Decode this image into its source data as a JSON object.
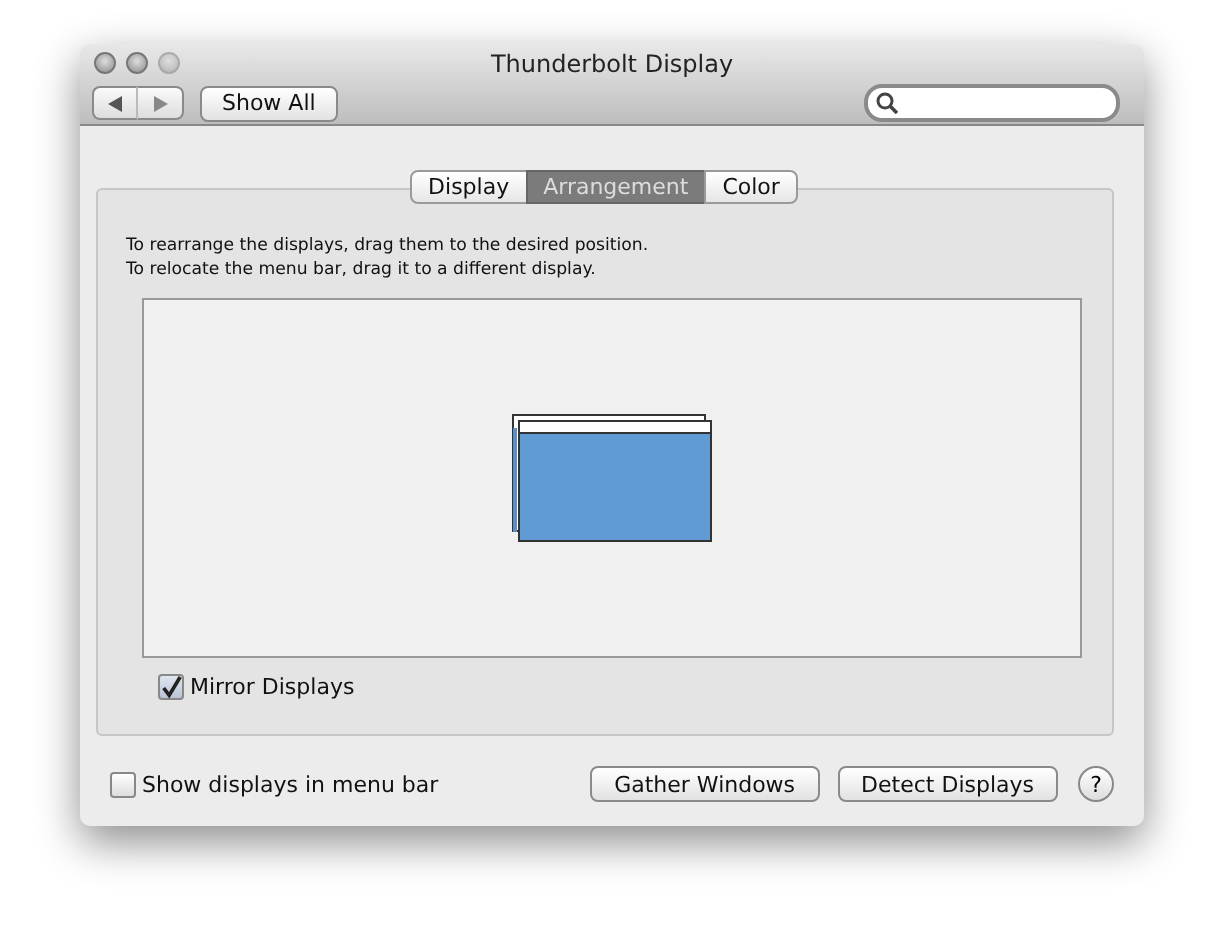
{
  "window": {
    "title": "Thunderbolt Display"
  },
  "toolbar": {
    "show_all": "Show All"
  },
  "tabs": [
    {
      "label": "Display",
      "selected": false
    },
    {
      "label": "Arrangement",
      "selected": true
    },
    {
      "label": "Color",
      "selected": false
    }
  ],
  "instructions": [
    "To rearrange the displays, drag them to the desired position.",
    "To relocate the menu bar, drag it to a different display."
  ],
  "mirror_displays": {
    "label": "Mirror Displays",
    "checked": true
  },
  "show_in_menu_bar": {
    "label": "Show displays in menu bar",
    "checked": false
  },
  "buttons": [
    "Gather Windows",
    "Detect Displays"
  ],
  "help": "?"
}
